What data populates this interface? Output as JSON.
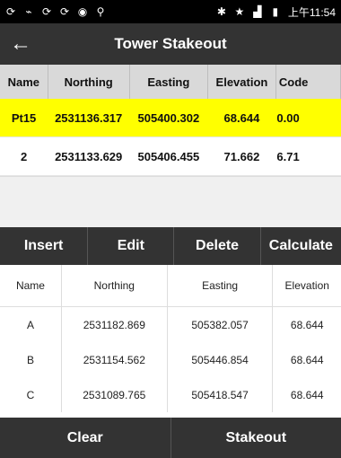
{
  "status_bar": {
    "time": "上午11:54"
  },
  "app_bar": {
    "title": "Tower Stakeout"
  },
  "top_table": {
    "headers": [
      "Name",
      "Northing",
      "Easting",
      "Elevation",
      "Code"
    ],
    "rows": [
      [
        "Pt15",
        "2531136.317",
        "505400.302",
        "68.644",
        "0.00"
      ],
      [
        "2",
        "2531133.629",
        "505406.455",
        "71.662",
        "6.71"
      ]
    ],
    "selected_row": 0
  },
  "actions": [
    "Insert",
    "Edit",
    "Delete",
    "Calculate"
  ],
  "bottom_table": {
    "headers": [
      "Name",
      "Northing",
      "Easting",
      "Elevation"
    ],
    "rows": [
      [
        "A",
        "2531182.869",
        "505382.057",
        "68.644"
      ],
      [
        "B",
        "2531154.562",
        "505446.854",
        "68.644"
      ],
      [
        "C",
        "2531089.765",
        "505418.547",
        "68.644"
      ]
    ]
  },
  "bottom_actions": [
    "Clear",
    "Stakeout"
  ],
  "colors": {
    "selected_row": "#ffff00",
    "bar": "#333333"
  }
}
